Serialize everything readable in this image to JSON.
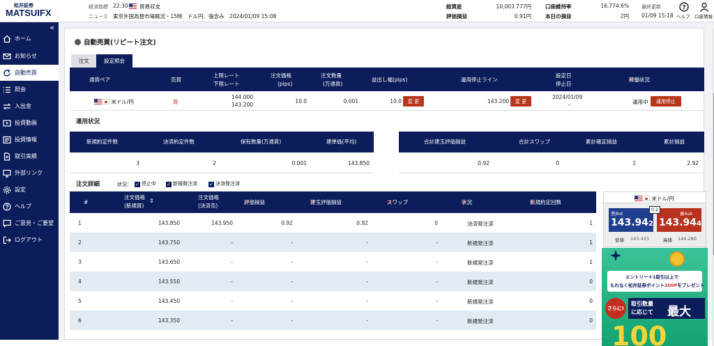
{
  "header": {
    "logo_top": "松井証券",
    "logo_main": "MATSUI",
    "logo_fx": "FX",
    "econ_label": "経済指標",
    "econ_time": "22:30",
    "econ_name": "貿易収支",
    "news_label": "ニュース",
    "news_text": "東京外国為替市場概況・15時　ドル円、強含み　2024/01/09 15:08",
    "total_assets_label": "総資産",
    "total_assets_value": "10,003.777円",
    "margin_rate_label": "口座維持率",
    "margin_rate_value": "16,774.6%",
    "last_update_label": "最終更新",
    "last_update_value": "01/09 15:18",
    "eval_pl_label": "評価損益",
    "eval_pl_value": "0.91円",
    "today_pl_label": "本日の損益",
    "today_pl_value": "2円",
    "help_label": "ヘルプ",
    "account_label": "口座情報"
  },
  "sidebar": {
    "collapse": "«",
    "items": [
      {
        "label": "ホーム",
        "icon": "home-icon"
      },
      {
        "label": "お知らせ",
        "icon": "mail-icon"
      },
      {
        "label": "自動売買",
        "icon": "refresh-icon"
      },
      {
        "label": "照会",
        "icon": "list-icon"
      },
      {
        "label": "入出金",
        "icon": "transfer-icon"
      },
      {
        "label": "投資動画",
        "icon": "video-icon"
      },
      {
        "label": "投資情報",
        "icon": "news-icon"
      },
      {
        "label": "取引実績",
        "icon": "document-icon"
      },
      {
        "label": "外部リンク",
        "icon": "monitor-icon"
      },
      {
        "label": "設定",
        "icon": "gear-icon"
      },
      {
        "label": "ヘルプ",
        "icon": "help-icon"
      },
      {
        "label": "ご意見・ご要望",
        "icon": "comment-icon"
      },
      {
        "label": "ログアウト",
        "icon": "logout-icon"
      }
    ],
    "active_index": 2
  },
  "page": {
    "title": "自動売買(リピート注文)",
    "tabs": [
      "注文",
      "設定照会"
    ]
  },
  "order_table": {
    "headers": [
      "通貨ペア",
      "売買",
      "上限レート",
      "下限レート",
      "注文価格",
      "(pips)",
      "注文数量",
      "(万通貨)",
      "益出し幅(pips)",
      "運用停止ライン",
      "設定日",
      "停止日",
      "稼働状況"
    ],
    "circle_6": "⑥",
    "pair": "米ドル/円",
    "side": "買",
    "upper": "144.000",
    "lower": "143.200",
    "order_pips": "10.0",
    "qty": "0.001",
    "profit_width": "10.0",
    "change_label": "変 更",
    "stop_line": "143.200",
    "set_date": "2024/01/09",
    "stop_date": "-",
    "status": "運用中",
    "stop_button": "運用停止"
  },
  "operation": {
    "title": "運用状況",
    "left_headers": [
      "新規約定件数",
      "決済約定件数",
      "保有数量(万通貨)",
      "建単価(平均)"
    ],
    "left_values": [
      "3",
      "2",
      "0.001",
      "143.850"
    ],
    "right_headers": [
      "合計建玉評価損益",
      "合計スワップ",
      "累計確定損益",
      "累計損益"
    ],
    "right_values": [
      "0.92",
      "0",
      "2",
      "2.92"
    ]
  },
  "details": {
    "title": "注文詳細",
    "filter_label": "状況：",
    "filters": [
      "停止中",
      "新規発注済",
      "決済発注済"
    ],
    "headers": {
      "num": "#",
      "new_price_1": "注文価格",
      "new_price_2": "(新規買)",
      "settle_price_1": "注文価格",
      "settle_price_2": "(決済売)",
      "c1": "①",
      "eval": "評価損益",
      "c2": "②",
      "pos_eval": "建玉評価損益",
      "c3": "③",
      "swap": "スワップ",
      "c4": "④",
      "status": "状況",
      "c5": "⑤",
      "count": "新規約定回数"
    },
    "rows": [
      {
        "n": "1",
        "new": "143.850",
        "settle": "143.950",
        "eval": "0.92",
        "pos": "0.92",
        "swap": "0",
        "status": "決済発注済",
        "count": "1"
      },
      {
        "n": "2",
        "new": "143.750",
        "settle": "-",
        "eval": "-",
        "pos": "-",
        "swap": "-",
        "status": "新規発注済",
        "count": "1"
      },
      {
        "n": "3",
        "new": "143.650",
        "settle": "-",
        "eval": "-",
        "pos": "-",
        "swap": "-",
        "status": "新規発注済",
        "count": "1"
      },
      {
        "n": "4",
        "new": "143.550",
        "settle": "-",
        "eval": "-",
        "pos": "-",
        "swap": "-",
        "status": "新規発注済",
        "count": "0"
      },
      {
        "n": "5",
        "new": "143.450",
        "settle": "-",
        "eval": "-",
        "pos": "-",
        "swap": "-",
        "status": "新規発注済",
        "count": "0"
      },
      {
        "n": "6",
        "new": "143.350",
        "settle": "-",
        "eval": "-",
        "pos": "-",
        "swap": "-",
        "status": "新規発注済",
        "count": "0"
      }
    ]
  },
  "rate_widget": {
    "pair": "米ドル/円",
    "bid_label": "売Bid",
    "ask_label": "買Ask",
    "spread": "0.2",
    "bid_main": "143.94",
    "bid_small": "2",
    "ask_main": "143.94",
    "ask_small": "4",
    "low_label": "安値",
    "low": "143.423",
    "high_label": "高値",
    "high": "144.280",
    "bid_color": "#1a3d8f",
    "ask_color": "#c62c22"
  },
  "ad": {
    "line1": "エントリー＋1取引以上で",
    "line2": "もれなく松井証券ポイント",
    "line2_em": "200P",
    "line2_end": "をプレゼント",
    "badge": "さらに!",
    "big1": "取引数量",
    "big2": "に応じて",
    "big3": "最大",
    "number": "100"
  }
}
